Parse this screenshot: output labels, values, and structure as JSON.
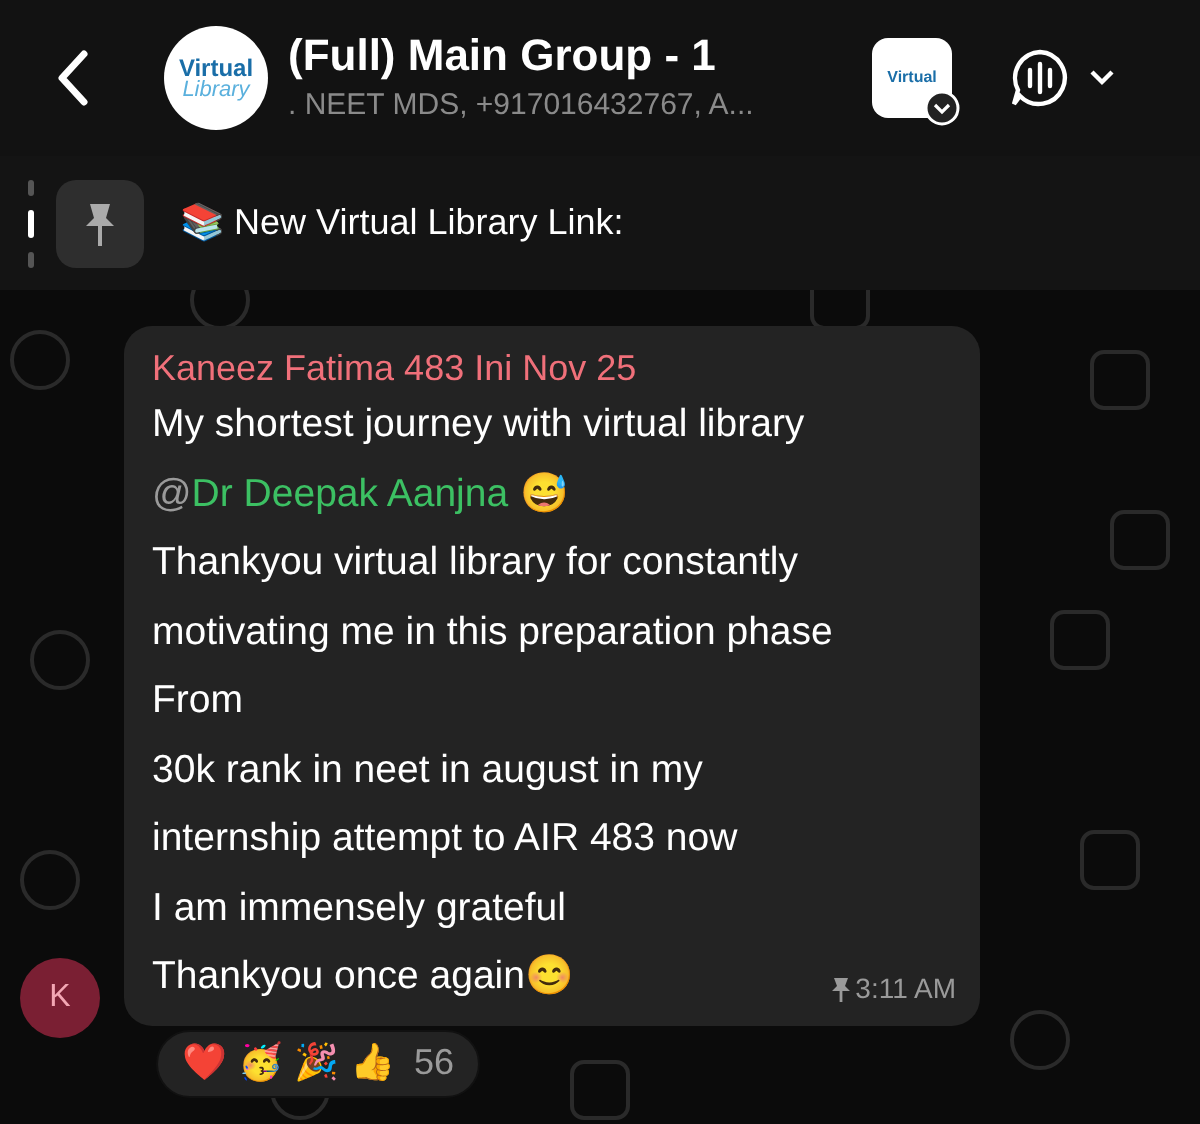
{
  "header": {
    "avatar": {
      "line1": "Virtual",
      "line2": "Library"
    },
    "title": "(Full) Main Group - 1",
    "subtitle": ". NEET MDS, +917016432767, A...",
    "channel_badge": {
      "text": "Virtual"
    }
  },
  "pinned": {
    "emoji": "📚",
    "text": "New Virtual Library Link:"
  },
  "message": {
    "sender": {
      "name": "Kaneez Fatima 483 Ini Nov 25",
      "color": "#f0707a"
    },
    "avatar_letter": "K",
    "lines": [
      {
        "kind": "text",
        "text": "My shortest journey with virtual library"
      },
      {
        "kind": "mention",
        "at": "@",
        "name": "Dr Deepak Aanjna",
        "emoji": "😅"
      },
      {
        "kind": "text",
        "text": "Thankyou virtual library for constantly"
      },
      {
        "kind": "text",
        "text": "motivating me in this preparation phase"
      },
      {
        "kind": "text",
        "text": "From"
      },
      {
        "kind": "text",
        "text": "30k rank in neet in august in my"
      },
      {
        "kind": "text",
        "text": "internship attempt to AIR 483 now"
      },
      {
        "kind": "text",
        "text": "I am immensely grateful"
      },
      {
        "kind": "text",
        "text": "Thankyou once again😊"
      }
    ],
    "pinned": true,
    "time": "3:11 AM",
    "reactions": {
      "emojis": [
        "❤️",
        "🥳",
        "🎉",
        "👍"
      ],
      "count": "56"
    }
  }
}
